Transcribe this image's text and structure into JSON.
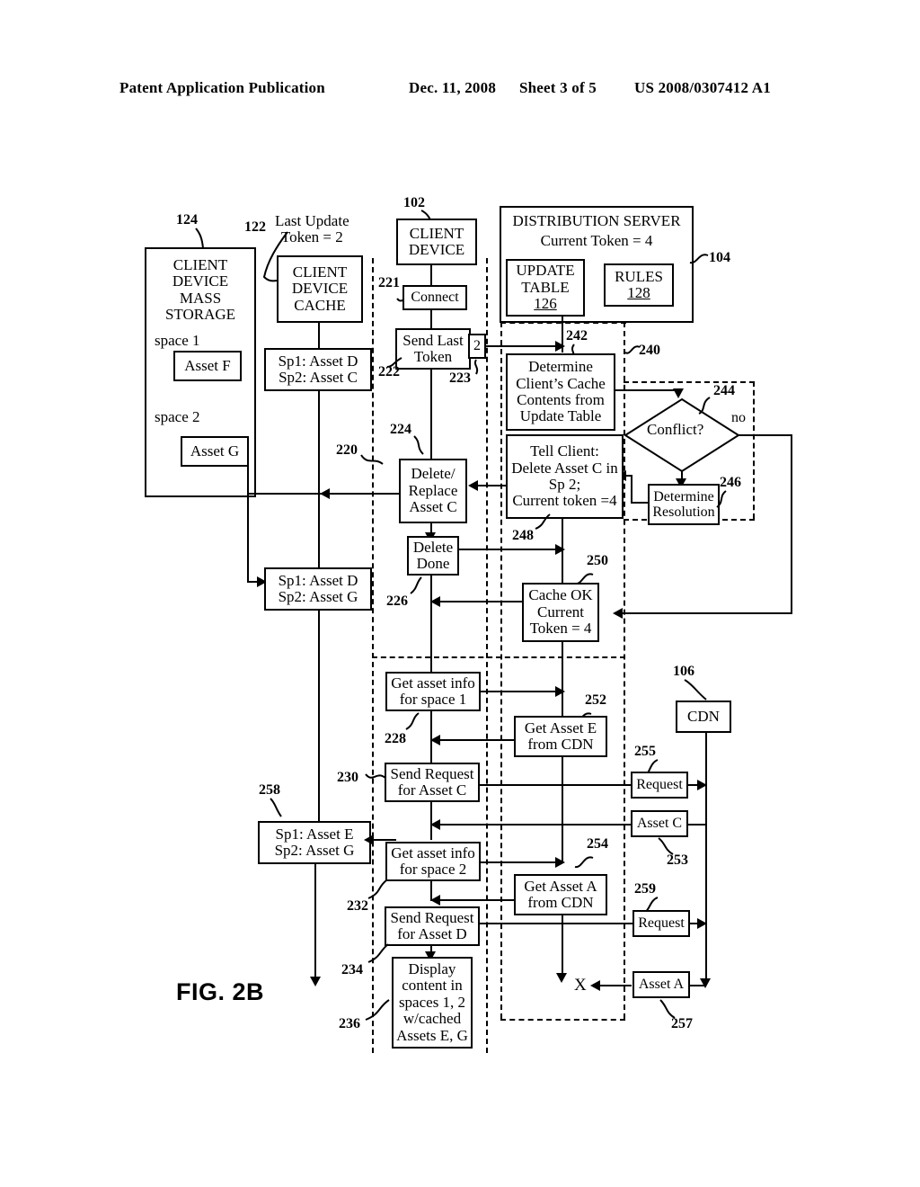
{
  "header": {
    "left": "Patent Application Publication",
    "date": "Dec. 11, 2008",
    "sheet": "Sheet 3 of 5",
    "pubnum": "US 2008/0307412 A1"
  },
  "figure": {
    "label": "FIG. 2B"
  },
  "ref_numerals": {
    "n102": "102",
    "n104": "104",
    "n106": "106",
    "n122": "122",
    "n124": "124",
    "n126": "126",
    "n128": "128",
    "n220": "220",
    "n221": "221",
    "n222": "222",
    "n223": "223",
    "n224": "224",
    "n226": "226",
    "n228": "228",
    "n230": "230",
    "n232": "232",
    "n234": "234",
    "n236": "236",
    "n240": "240",
    "n242": "242",
    "n244": "244",
    "n246": "246",
    "n248": "248",
    "n250": "250",
    "n252": "252",
    "n253": "253",
    "n254": "254",
    "n255": "255",
    "n257": "257",
    "n258": "258",
    "n259": "259"
  },
  "mass_storage": {
    "title_lines": [
      "CLIENT",
      "DEVICE",
      "MASS",
      "STORAGE"
    ],
    "space1_label": "space 1",
    "space1_asset": "Asset F",
    "space2_label": "space 2",
    "space2_asset": "Asset G"
  },
  "cache": {
    "annotation_lines": [
      "Last Update",
      "Token = 2"
    ],
    "title_lines": [
      "CLIENT",
      "DEVICE",
      "CACHE"
    ],
    "state_initial": [
      "Sp1: Asset D",
      "Sp2: Asset C"
    ],
    "state_after_delete": [
      "Sp1: Asset D",
      "Sp2: Asset G"
    ],
    "state_final": [
      "Sp1: Asset E",
      "Sp2: Asset G"
    ]
  },
  "client_device": {
    "title_lines": [
      "CLIENT",
      "DEVICE"
    ]
  },
  "distribution_server": {
    "title": "DISTRIBUTION SERVER",
    "current_token": "Current Token = 4",
    "update_table_lines": [
      "UPDATE",
      "TABLE"
    ],
    "update_table_num": "126",
    "rules_label": "RULES",
    "rules_num": "128"
  },
  "cdn": {
    "label": "CDN"
  },
  "client_steps": {
    "connect": "Connect",
    "send_last_token": [
      "Send Last",
      "Token"
    ],
    "token_badge": "2",
    "delete_replace": [
      "Delete/",
      "Replace",
      "Asset C"
    ],
    "delete_done": [
      "Delete",
      "Done"
    ],
    "get_info_space1": [
      "Get asset info",
      "for space 1"
    ],
    "send_request_c": [
      "Send Request",
      "for Asset C"
    ],
    "get_info_space2": [
      "Get asset info",
      "for space 2"
    ],
    "send_request_d": [
      "Send Request",
      "for Asset D"
    ],
    "display": [
      "Display",
      "content in",
      "spaces 1, 2",
      "w/cached",
      "Assets E, G"
    ]
  },
  "server_steps": {
    "determine_cache": [
      "Determine",
      "Client’s Cache",
      "Contents from",
      "Update Table"
    ],
    "conflict": "Conflict?",
    "conflict_no": "no",
    "determine_resolution": [
      "Determine",
      "Resolution"
    ],
    "tell_client": [
      "Tell Client:",
      "Delete Asset C in",
      "Sp 2;",
      "Current token =4"
    ],
    "cache_ok": [
      "Cache OK",
      "Current",
      "Token = 4"
    ],
    "get_asset_e": [
      "Get Asset E",
      "from CDN"
    ],
    "get_asset_a": [
      "Get Asset A",
      "from CDN"
    ],
    "terminator": "X"
  },
  "cdn_steps": {
    "request_1": "Request",
    "asset_c": "Asset C",
    "request_2": "Request",
    "asset_a": "Asset A"
  },
  "colors": {
    "ink": "#000000",
    "paper": "#ffffff"
  }
}
